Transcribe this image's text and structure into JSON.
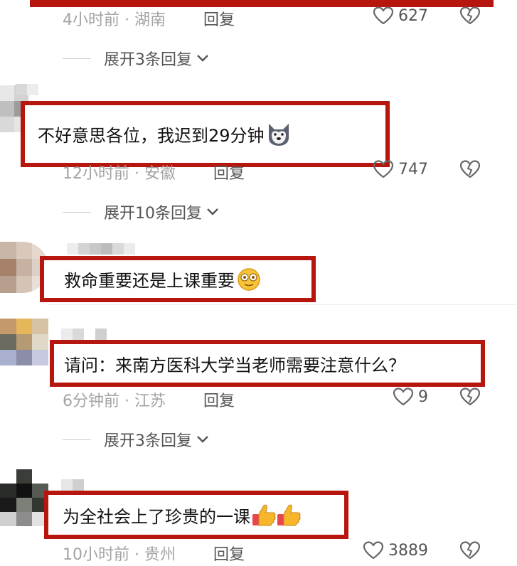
{
  "comments": [
    {
      "time": "4小时前",
      "location": "湖南",
      "reply_label": "回复",
      "likes": "627",
      "expand": "展开3条回复"
    },
    {
      "text": "不好意思各位，我迟到29分钟",
      "emoji": "husky-emoji",
      "time": "12小时前",
      "location": "安徽",
      "reply_label": "回复",
      "likes": "747",
      "expand": "展开10条回复"
    },
    {
      "text": "救命重要还是上课重要",
      "emoji": "dazed-face-emoji"
    },
    {
      "text": "请问：来南方医科大学当老师需要注意什么？",
      "time": "6分钟前",
      "location": "江苏",
      "reply_label": "回复",
      "likes": "9",
      "expand": "展开3条回复"
    },
    {
      "text": "为全社会上了珍贵的一课",
      "emoji": "thumbs-up-emoji",
      "time": "10小时前",
      "location": "贵州",
      "reply_label": "回复",
      "likes": "3889"
    }
  ],
  "colors": {
    "highlight_border": "#b7160f",
    "meta_text": "#a3a3a3",
    "action_text": "#555555"
  },
  "icons": [
    "heart-icon",
    "dislike-icon",
    "chevron-down-icon"
  ]
}
